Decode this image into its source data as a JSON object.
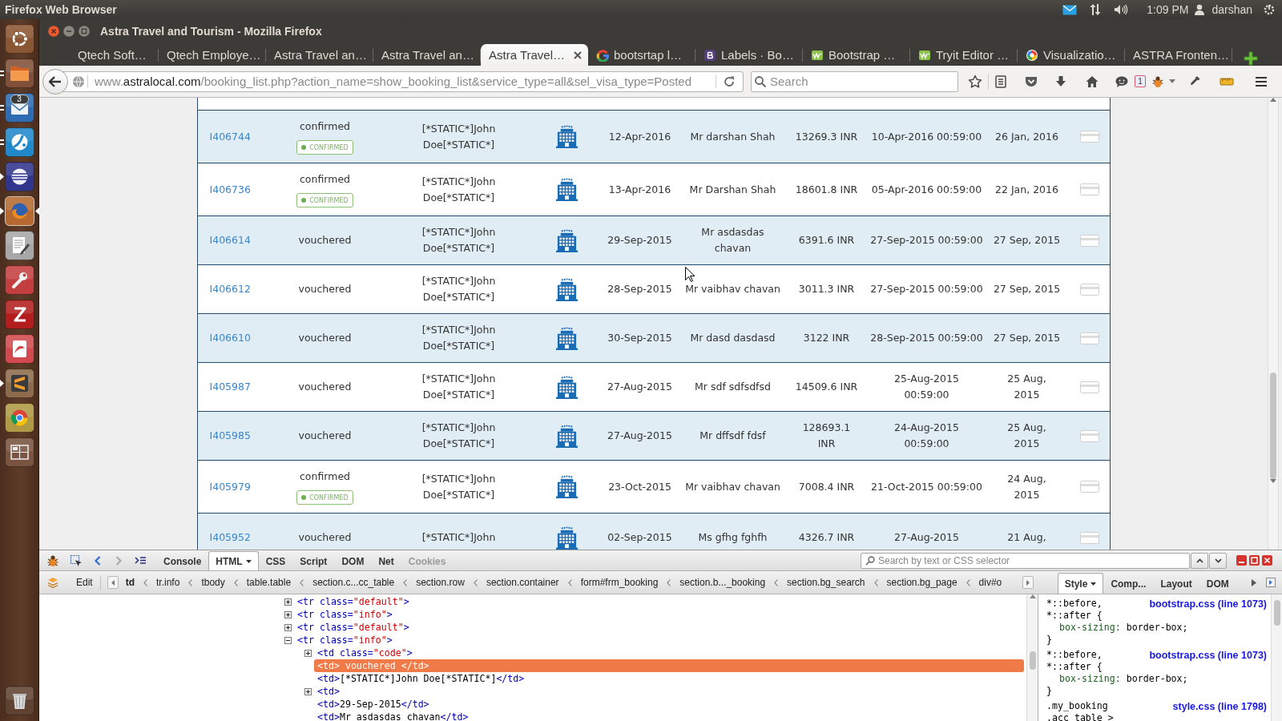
{
  "system_bar": {
    "title": "Firefox Web Browser",
    "time": "1:09 PM",
    "user": "darshan"
  },
  "launcher": {
    "items": [
      {
        "kind": "dash",
        "focused": false
      },
      {
        "kind": "files",
        "indicator": {
          "kind": "double"
        },
        "focused": false
      },
      {
        "kind": "mail",
        "indicator": {
          "kind": "double"
        },
        "focused": false,
        "badge": "3"
      },
      {
        "kind": "remote",
        "indicator": {
          "kind": "double"
        },
        "focused": false
      },
      {
        "kind": "eclipse",
        "indicator": {
          "kind": "single"
        },
        "focused": false
      },
      {
        "kind": "firefox",
        "indicator": {
          "kind": "single"
        },
        "focused": true
      },
      {
        "kind": "editor",
        "focused": false
      },
      {
        "kind": "settings",
        "focused": false
      },
      {
        "kind": "ftp",
        "focused": false
      },
      {
        "kind": "reader",
        "focused": false
      },
      {
        "kind": "sublime",
        "indicator": {
          "kind": "single"
        },
        "focused": false
      },
      {
        "kind": "chrome",
        "focused": false
      },
      {
        "kind": "workspaces",
        "focused": false
      }
    ],
    "bottom_items": [
      {
        "kind": "trash",
        "focused": false
      }
    ]
  },
  "browser": {
    "window_title": "Astra Travel and Tourism - Mozilla Firefox",
    "tabs": [
      {
        "label": "Qtech Soft…",
        "selected": false
      },
      {
        "label": "Qtech Employe…",
        "selected": false
      },
      {
        "label": "Astra Travel an…",
        "selected": false
      },
      {
        "label": "Astra Travel an…",
        "selected": false
      },
      {
        "label": "Astra Travel…",
        "selected": true
      },
      {
        "label": "bootsrtap l…",
        "selected": false,
        "favicon": {
          "kind": "ring"
        }
      },
      {
        "label": "Labels · Bo…",
        "selected": false,
        "favicon": {
          "kind": "square"
        }
      },
      {
        "label": "Bootstrap …",
        "selected": false,
        "favicon": {
          "kind": "wave"
        }
      },
      {
        "label": "Tryit Editor …",
        "selected": false,
        "favicon": {
          "kind": "wave"
        }
      },
      {
        "label": "Visualizatio…",
        "selected": false,
        "favicon": {
          "kind": "pinwheel"
        }
      },
      {
        "label": "ASTRA Fronten…",
        "selected": false
      }
    ],
    "url": {
      "subdomain": "www.",
      "domain": "astralocal.com",
      "path": "/booking_list.php?action_name=show_booking_list&service_type=all&sel_visa_type=Posted"
    },
    "search": {
      "placeholder": "Search"
    },
    "notification_badge": "1"
  },
  "bookings": {
    "rows": [
      {
        "kind": "info",
        "column_1": "I406744",
        "column_2": "confirmed",
        "badge": "CONFIRMED",
        "column_3": "[*STATIC*]John Doe[*STATIC*]",
        "column_5": "12-Apr-2016",
        "column_6": "Mr darshan Shah",
        "column_7": "13269.3 INR",
        "column_8": "10-Apr-2016 00:59:00",
        "column_9": "26 Jan, 2016"
      },
      {
        "kind": "default",
        "column_1": "I406736",
        "column_2": "confirmed",
        "badge": "CONFIRMED",
        "column_3": "[*STATIC*]John Doe[*STATIC*]",
        "column_5": "13-Apr-2016",
        "column_6": "Mr Darshan Shah",
        "column_7": "18601.8 INR",
        "column_8": "05-Apr-2016 00:59:00",
        "column_9": "22 Jan, 2016"
      },
      {
        "kind": "info",
        "column_1": "I406614",
        "column_2": "vouchered",
        "column_3": "[*STATIC*]John Doe[*STATIC*]",
        "column_5": "29-Sep-2015",
        "column_6": "Mr asdasdas chavan",
        "column_7": "6391.6 INR",
        "column_8": "27-Sep-2015 00:59:00",
        "column_9": "27 Sep, 2015"
      },
      {
        "kind": "default",
        "column_1": "I406612",
        "column_2": "vouchered",
        "column_3": "[*STATIC*]John Doe[*STATIC*]",
        "column_5": "28-Sep-2015",
        "column_6": "Mr vaibhav chavan",
        "column_7": "3011.3 INR",
        "column_8": "27-Sep-2015 00:59:00",
        "column_9": "27 Sep, 2015"
      },
      {
        "kind": "info",
        "column_1": "I406610",
        "column_2": "vouchered",
        "column_3": "[*STATIC*]John Doe[*STATIC*]",
        "column_5": "30-Sep-2015",
        "column_6": "Mr dasd dasdasd",
        "column_7": "3122 INR",
        "column_8": "28-Sep-2015 00:59:00",
        "column_9": "27 Sep, 2015"
      },
      {
        "kind": "default",
        "column_1": "I405987",
        "column_2": "vouchered",
        "column_3": "[*STATIC*]John Doe[*STATIC*]",
        "column_5": "27-Aug-2015",
        "column_6": "Mr sdf sdfsdfsd",
        "column_7": "14509.6 INR",
        "column_8": "25-Aug-2015 00:59:00",
        "column_9": "25 Aug, 2015"
      },
      {
        "kind": "info",
        "column_1": "I405985",
        "column_2": "vouchered",
        "column_3": "[*STATIC*]John Doe[*STATIC*]",
        "column_5": "27-Aug-2015",
        "column_6": "Mr dffsdf fdsf",
        "column_7": "128693.1 INR",
        "column_8": "24-Aug-2015 00:59:00",
        "column_9": "25 Aug, 2015"
      },
      {
        "kind": "default",
        "column_1": "I405979",
        "column_2": "confirmed",
        "badge": "CONFIRMED",
        "column_3": "[*STATIC*]John Doe[*STATIC*]",
        "column_5": "23-Oct-2015",
        "column_6": "Mr vaibhav chavan",
        "column_7": "7008.4 INR",
        "column_8": "21-Oct-2015 00:59:00",
        "column_9": "24 Aug, 2015"
      },
      {
        "kind": "info",
        "column_1": "I405952",
        "column_2": "vouchered",
        "column_3": "[*STATIC*]John",
        "column_5": "02-Sep-2015",
        "column_6": "Ms gfhg fghfh",
        "column_7": "4326.7 INR",
        "column_8": "27-Aug-2015",
        "column_9": "21 Aug,"
      }
    ]
  },
  "devtools": {
    "back": {
      "disabled": false
    },
    "forward": {
      "disabled": true
    },
    "tabs": [
      {
        "label": "Console",
        "selected": false,
        "disabled": false
      },
      {
        "label": "HTML",
        "selected": true,
        "disabled": false
      },
      {
        "label": "CSS",
        "selected": false,
        "disabled": false
      },
      {
        "label": "Script",
        "selected": false,
        "disabled": false
      },
      {
        "label": "DOM",
        "selected": false,
        "disabled": false
      },
      {
        "label": "Net",
        "selected": false,
        "disabled": false
      },
      {
        "label": "Cookies",
        "selected": false,
        "disabled": true
      }
    ],
    "search": {
      "placeholder": "Search by text or CSS selector"
    },
    "edit_label": "Edit",
    "breadcrumbs": [
      {
        "label": "td",
        "selected": true
      },
      {
        "label": "tr.info",
        "selected": false
      },
      {
        "label": "tbody",
        "selected": false
      },
      {
        "label": "table.table",
        "selected": false
      },
      {
        "label": "section.c...cc_table",
        "selected": false
      },
      {
        "label": "section.row",
        "selected": false
      },
      {
        "label": "section.container",
        "selected": false
      },
      {
        "label": "form#frm_booking",
        "selected": false
      },
      {
        "label": "section.b..._booking",
        "selected": false
      },
      {
        "label": "section.bg_search",
        "selected": false
      },
      {
        "label": "section.bg_page",
        "selected": false
      },
      {
        "label": "div#o",
        "selected": false
      }
    ],
    "side_tabs": [
      {
        "label": "Style",
        "selected": true
      },
      {
        "label": "Comp...",
        "selected": false
      },
      {
        "label": "Layout",
        "selected": false
      },
      {
        "label": "DOM",
        "selected": false
      }
    ],
    "html_tree": [
      {
        "kind": "branch",
        "expanded": false,
        "selected": false,
        "parts": [
          {
            "kind": "tag",
            "text": "<tr"
          },
          {
            "kind": "attr",
            "text": " class="
          },
          {
            "kind": "value",
            "text": "\"default\""
          },
          {
            "kind": "tag",
            "text": ">"
          }
        ]
      },
      {
        "kind": "branch",
        "expanded": false,
        "selected": false,
        "parts": [
          {
            "kind": "tag",
            "text": "<tr"
          },
          {
            "kind": "attr",
            "text": " class="
          },
          {
            "kind": "value",
            "text": "\"info\""
          },
          {
            "kind": "tag",
            "text": ">"
          }
        ]
      },
      {
        "kind": "branch",
        "expanded": false,
        "selected": false,
        "parts": [
          {
            "kind": "tag",
            "text": "<tr"
          },
          {
            "kind": "attr",
            "text": " class="
          },
          {
            "kind": "value",
            "text": "\"default\""
          },
          {
            "kind": "tag",
            "text": ">"
          }
        ]
      },
      {
        "kind": "branch",
        "expanded": true,
        "selected": false,
        "parts": [
          {
            "kind": "tag",
            "text": "<tr"
          },
          {
            "kind": "attr",
            "text": " class="
          },
          {
            "kind": "value",
            "text": "\"info\""
          },
          {
            "kind": "tag",
            "text": ">"
          }
        ],
        "children": [
          {
            "kind": "branch",
            "expanded": false,
            "selected": false,
            "parts": [
              {
                "kind": "tag",
                "text": "<td"
              },
              {
                "kind": "attr",
                "text": " class="
              },
              {
                "kind": "value",
                "text": "\"code\""
              },
              {
                "kind": "tag",
                "text": ">"
              }
            ]
          },
          {
            "kind": "leaf",
            "selected": true,
            "parts": [
              {
                "text": "<td>"
              },
              {
                "text": " vouchered "
              },
              {
                "text": "</td>"
              }
            ]
          },
          {
            "kind": "leaf",
            "selected": false,
            "parts": [
              {
                "kind": "tag",
                "text": "<td>"
              },
              {
                "kind": "text",
                "text": "[*STATIC*]John Doe[*STATIC*]"
              },
              {
                "kind": "tag",
                "text": "</td>"
              }
            ]
          },
          {
            "kind": "branch",
            "expanded": false,
            "selected": false,
            "parts": [
              {
                "kind": "tag",
                "text": "<td>"
              }
            ]
          },
          {
            "kind": "leaf",
            "selected": false,
            "parts": [
              {
                "kind": "tag",
                "text": "<td>"
              },
              {
                "kind": "text",
                "text": "29-Sep-2015"
              },
              {
                "kind": "tag",
                "text": "</td>"
              }
            ]
          },
          {
            "kind": "leaf",
            "selected": false,
            "parts": [
              {
                "kind": "tag",
                "text": "<td>"
              },
              {
                "kind": "text",
                "text": "Mr asdasdas chavan"
              },
              {
                "kind": "tag",
                "text": "</td>"
              }
            ]
          }
        ]
      }
    ],
    "style_rules": [
      {
        "selectors": [
          "*::before,",
          "*::after {"
        ],
        "source": "bootstrap.css (line 1073)",
        "declarations": [
          {
            "property": "box-sizing:",
            "value": "border-box;"
          }
        ],
        "close": "}"
      },
      {
        "selectors": [
          "*::before,",
          "*::after {"
        ],
        "source": "bootstrap.css (line 1073)",
        "declarations": [
          {
            "property": "box-sizing:",
            "value": "border-box;"
          }
        ],
        "close": "}"
      },
      {
        "selectors": [
          ".my_booking",
          ".acc table >"
        ],
        "source": "style.css (line 1798)"
      }
    ]
  }
}
